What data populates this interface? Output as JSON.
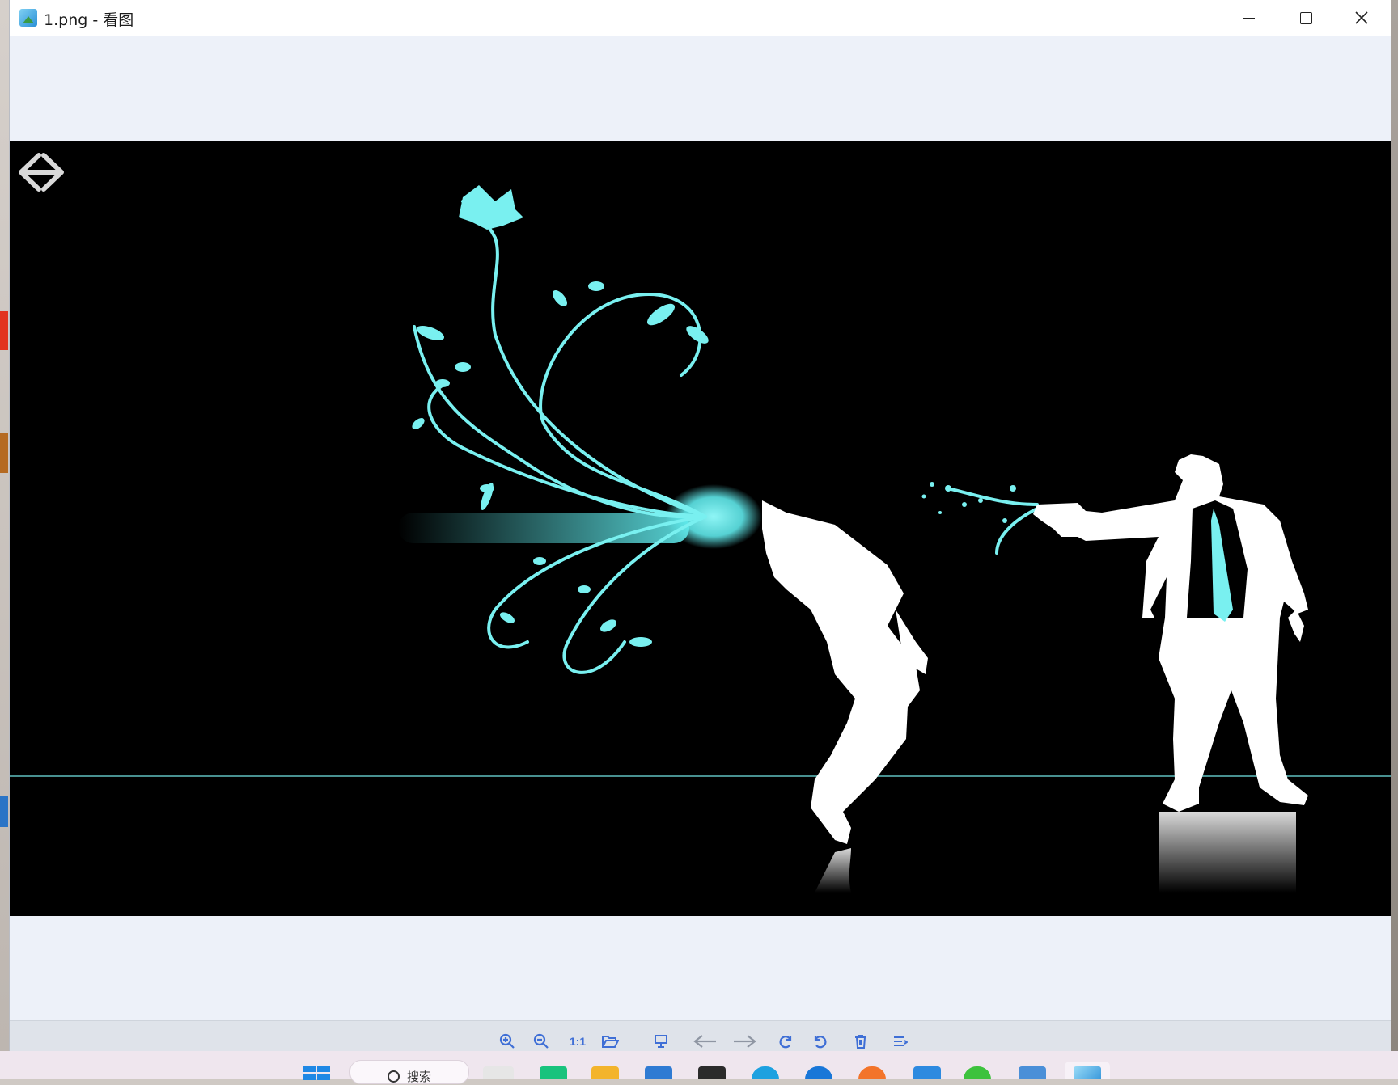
{
  "window": {
    "title": "1.png - 看图",
    "controls": {
      "minimize": "minimize",
      "maximize": "maximize",
      "close": "close"
    }
  },
  "viewer": {
    "image_alt": "Silhouette of a man in a suit shooting another man whose head bursts into cyan floral vines, black background",
    "prev_label": "previous image",
    "next_label": "next image"
  },
  "toolbar": {
    "items": [
      {
        "name": "zoom-in-icon"
      },
      {
        "name": "zoom-out-icon"
      },
      {
        "name": "actual-size-button",
        "label": "1:1"
      },
      {
        "name": "open-folder-icon"
      },
      {
        "name": "slideshow-icon"
      },
      {
        "name": "prev-arrow-icon"
      },
      {
        "name": "next-arrow-icon"
      },
      {
        "name": "rotate-right-icon"
      },
      {
        "name": "rotate-left-icon"
      },
      {
        "name": "delete-icon"
      },
      {
        "name": "more-menu-icon"
      }
    ]
  },
  "taskbar": {
    "search_label": "搜索",
    "apps": [
      "start",
      "search",
      "taskview",
      "app-green",
      "file-explorer",
      "store",
      "app-dark",
      "edge",
      "edge-beta",
      "firefox",
      "notepad",
      "wechat",
      "app-blue",
      "photo-viewer"
    ]
  },
  "colors": {
    "accent": "#79f0f0",
    "window_bg": "#edf1f9",
    "toolbar_icon": "#3f6fd6"
  }
}
